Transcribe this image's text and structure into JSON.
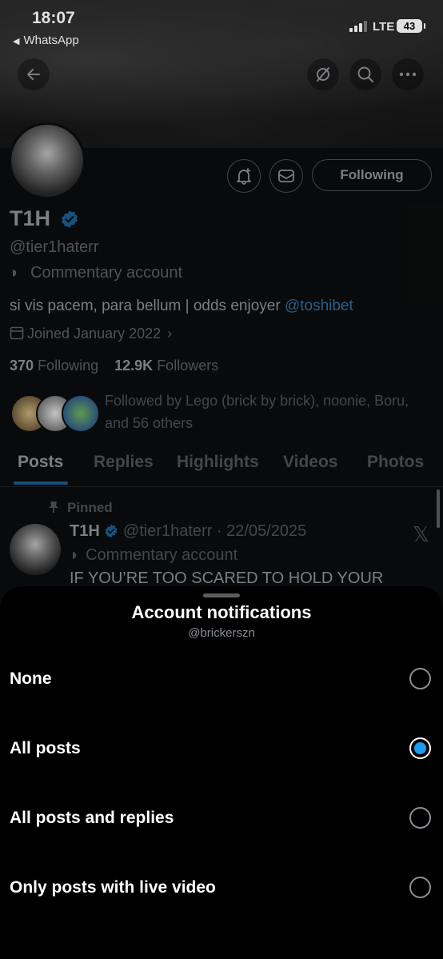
{
  "status_bar": {
    "time": "18:07",
    "back_app": "WhatsApp",
    "network": "LTE",
    "battery": "43"
  },
  "profile": {
    "name": "T1H",
    "handle": "@tier1haterr",
    "category": "Commentary account",
    "bio_text": "si vis pacem, para bellum | odds enjoyer ",
    "bio_mention": "@toshibet",
    "joined": "Joined January 2022",
    "following_count": "370",
    "following_label": "Following",
    "followers_count": "12.9K",
    "followers_label": "Followers",
    "following_button": "Following",
    "followed_by_text": "Followed by Lego (brick by brick), noonie, Boru, and 56 others"
  },
  "tabs": [
    "Posts",
    "Replies",
    "Highlights",
    "Videos",
    "Photos"
  ],
  "pinned_post": {
    "pinned_label": "Pinned",
    "name": "T1H",
    "meta": "@tier1haterr · 22/05/2025",
    "category": "Commentary account",
    "text": "IF YOU’RE TOO SCARED TO HOLD YOUR"
  },
  "sheet": {
    "title": "Account notifications",
    "subtitle": "@brickerszn",
    "options": [
      {
        "label": "None",
        "selected": false
      },
      {
        "label": "All posts",
        "selected": true
      },
      {
        "label": "All posts and replies",
        "selected": false
      },
      {
        "label": "Only posts with live video",
        "selected": false
      }
    ]
  },
  "colors": {
    "accent": "#1d9bf0",
    "sheet_bg": "#000000",
    "verified": "#1d9bf0"
  },
  "icons": [
    "back-arrow-icon",
    "hide-icon",
    "search-icon",
    "more-icon",
    "bell-plus-icon",
    "mail-icon",
    "verified-icon",
    "mask-icon",
    "calendar-icon",
    "pin-icon",
    "x-logo-icon"
  ]
}
